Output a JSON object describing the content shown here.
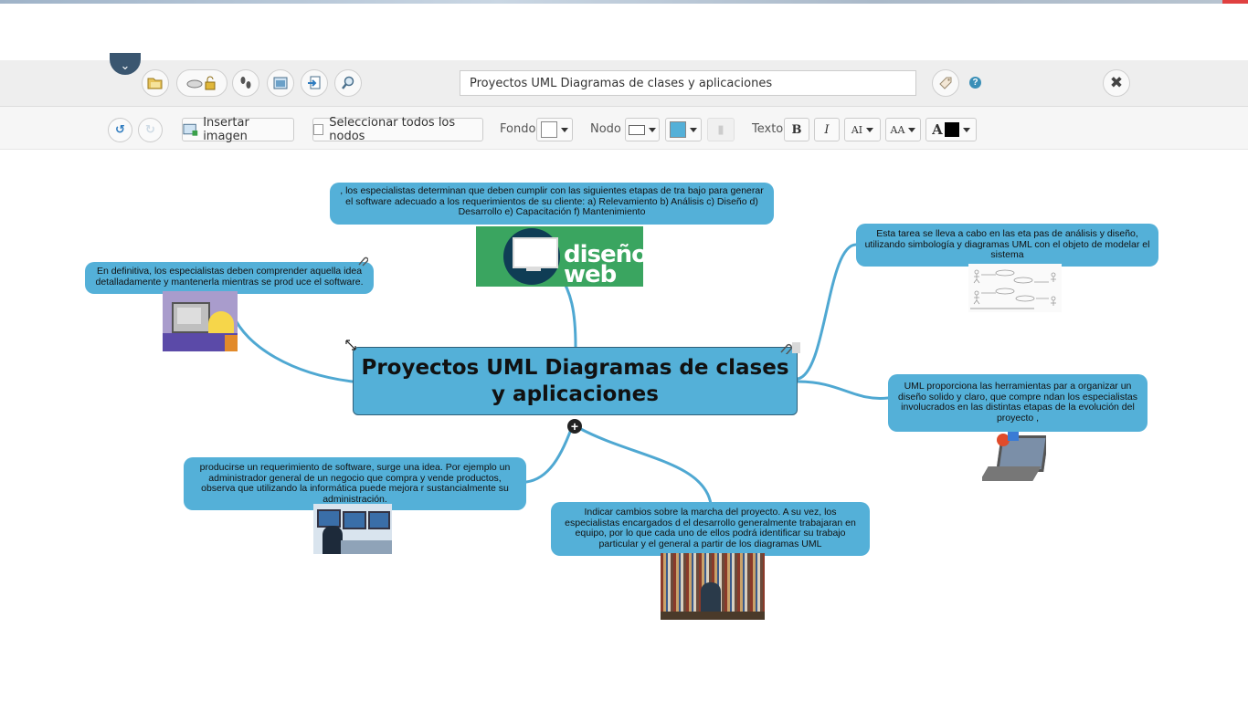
{
  "toolbar_top": {
    "title_value": "Proyectos UML Diagramas de clases y aplicaciones",
    "icons": [
      "folder-open-icon",
      "cloud-lock-icon",
      "footprints-icon",
      "image-window-icon",
      "export-icon",
      "zoom-icon",
      "tag-icon",
      "help-icon",
      "close-icon",
      "chevron-down-icon"
    ],
    "help_label": "?"
  },
  "toolbar_format": {
    "insert_image_label": "Insertar imagen",
    "select_all_label": "Seleccionar todos los nodos",
    "fondo_label": "Fondo",
    "nodo_label": "Nodo",
    "texto_label": "Texto",
    "bold_label": "B",
    "italic_label": "I",
    "font_size_label": "AI",
    "font_case_label": "AA",
    "text_color_label": "A",
    "node_fill_color": "#54b0d8",
    "text_color": "#000000"
  },
  "mindmap": {
    "central": "Proyectos UML Diagramas de clases y aplicaciones",
    "expand_label": "+",
    "nodes": [
      {
        "id": "top",
        "text": ", los especialistas determinan que deben cumplir con las siguientes etapas de tra bajo para generar el software adecuado a los requerimientos de su cliente: a) Relevamiento b) Análisis c) Diseño d) Desarrollo e) Capacitación f) Mantenimiento",
        "image": "diseño web"
      },
      {
        "id": "left-top",
        "text": "En definitiva, los especialistas deben comprender aquella idea detalladamente y mantenerla mientras se prod uce el software."
      },
      {
        "id": "right-top",
        "text": "Esta tarea se lleva a cabo en las eta pas de análisis y diseño, utilizando simbología y diagramas UML con el objeto de modelar el sistema"
      },
      {
        "id": "right-mid",
        "text": "UML proporciona las herramientas par a organizar un diseño solido y claro, que compre ndan los especialistas involucrados en las distintas etapas de la evolución del proyecto ,"
      },
      {
        "id": "left-bottom",
        "text": "producirse un requerimiento de software, surge una idea. Por ejemplo un administrador general de un negocio que compra y vende productos, observa que utilizando la informática puede mejora r sustancialmente su administración."
      },
      {
        "id": "bottom",
        "text": "Indicar cambios sobre la marcha del proyecto. A su vez, los especialistas encargados d el desarrollo generalmente trabajaran en equipo, por lo que cada uno de ellos podrá identificar su trabajo particular y el general a partir de los diagramas UML"
      }
    ]
  }
}
